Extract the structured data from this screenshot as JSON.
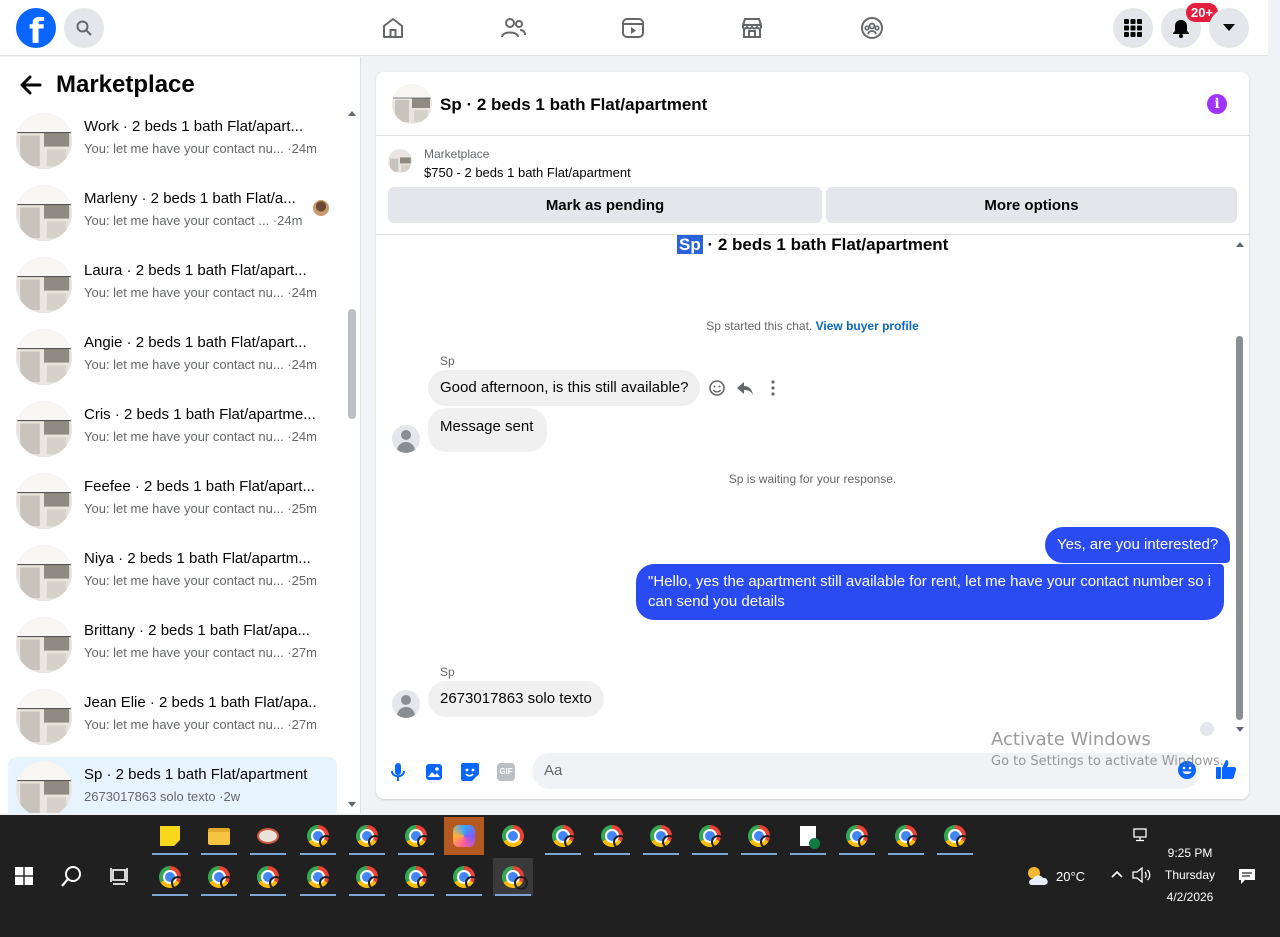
{
  "topbar": {
    "logo_letter": "f",
    "notifications_badge": "20+"
  },
  "sidebar": {
    "title": "Marketplace",
    "conversations": [
      {
        "name": "Work · 2 beds 1 bath Flat/apart...",
        "preview": "You: let me have your contact nu... ·24m"
      },
      {
        "name": "Marleny · 2 beds 1 bath Flat/a...",
        "preview": "You: let me have your contact ... ·24m"
      },
      {
        "name": "Laura · 2 beds 1 bath Flat/apart...",
        "preview": "You: let me have your contact nu... ·24m"
      },
      {
        "name": "Angie · 2 beds 1 bath Flat/apart...",
        "preview": "You: let me have your contact nu... ·24m"
      },
      {
        "name": "Cris · 2 beds 1 bath Flat/apartme...",
        "preview": "You: let me have your contact nu... ·24m"
      },
      {
        "name": "Feefee · 2 beds 1 bath Flat/apart...",
        "preview": "You: let me have your contact nu... ·25m"
      },
      {
        "name": "Niya · 2 beds 1 bath Flat/apartm...",
        "preview": "You: let me have your contact nu... ·25m"
      },
      {
        "name": "Brittany · 2 beds 1 bath Flat/apa...",
        "preview": "You: let me have your contact nu... ·27m"
      },
      {
        "name": "Jean Elie · 2 beds 1 bath Flat/apa...",
        "preview": "You: let me have your contact nu... ·27m"
      },
      {
        "name": "Sp · 2 beds 1 bath Flat/apartment",
        "preview": "2673017863 solo texto ·2w"
      }
    ]
  },
  "chat": {
    "header_title": "Sp · 2 beds 1 bath Flat/apartment",
    "listing_source": "Marketplace",
    "listing_price": "$750 - 2 beds 1 bath Flat/apartment",
    "mark_pending_label": "Mark as pending",
    "more_options_label": "More options",
    "convo_title_highlight": "Sp",
    "convo_title_rest": " · 2 beds 1 bath Flat/apartment",
    "started_text": "Sp started this chat. ",
    "view_buyer_label": "View buyer profile",
    "sender_name": "Sp",
    "msg_1": "Good afternoon, is this still available?",
    "msg_2": "Message sent",
    "waiting_text": "Sp is waiting for your response.",
    "reply_1": "Yes, are you interested?",
    "reply_2": "\"Hello, yes the  apartment still available for rent, let me have your contact number so i can send you details",
    "msg_3": "2673017863 solo texto",
    "composer_placeholder": "Aa",
    "gif_label": "GIF"
  },
  "watermark": {
    "line1": "Activate Windows",
    "line2": "Go to Settings to activate Windows."
  },
  "taskbar": {
    "temperature": "20°C",
    "time": "9:25 PM",
    "day": "Thursday",
    "date": "4/2/2026"
  },
  "colors": {
    "brand": "#0866ff",
    "outgoing_bubble": "#2b4bf2",
    "badge": "#e41e3f",
    "info": "#a033ff"
  }
}
